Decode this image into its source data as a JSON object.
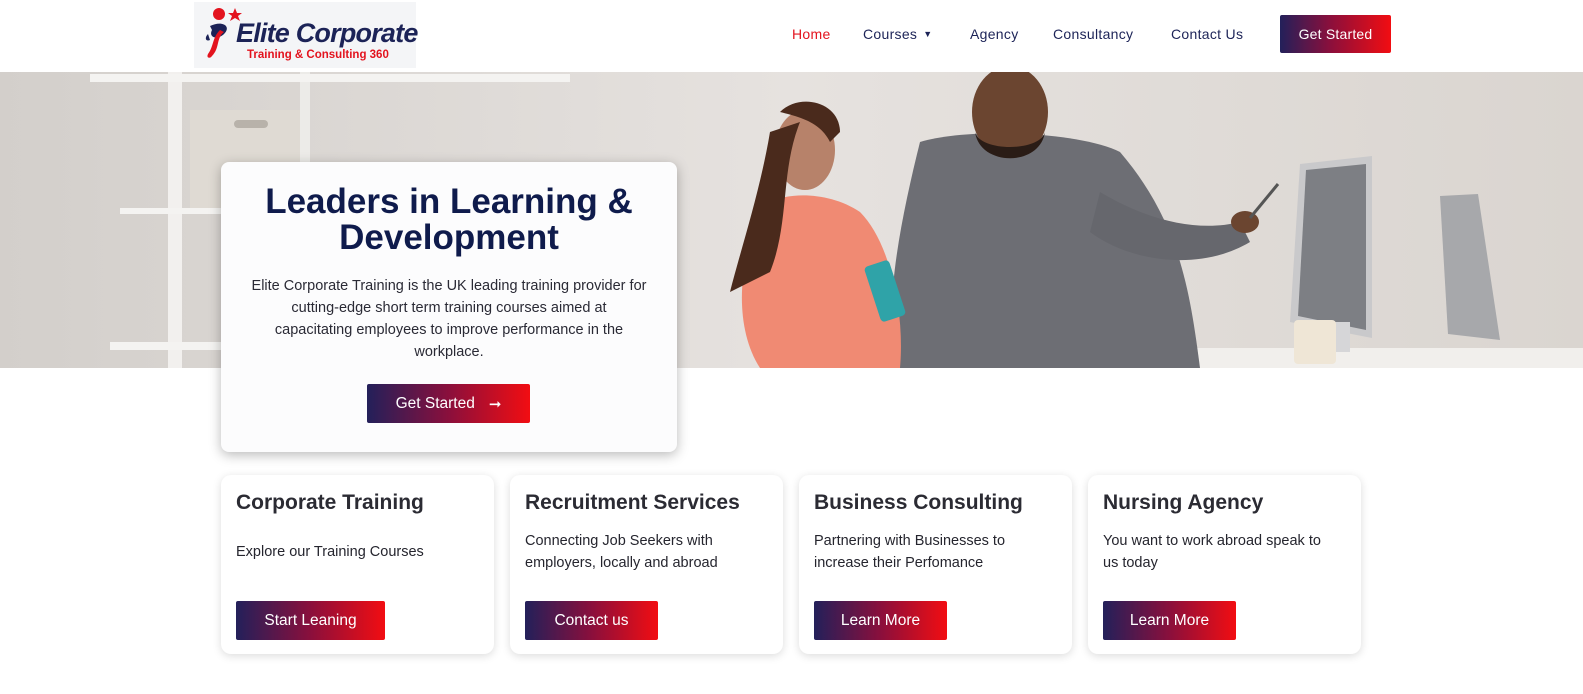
{
  "header": {
    "logo": {
      "title": "Elite Corporate",
      "subtitle": "Training & Consulting 360"
    },
    "nav": [
      {
        "label": "Home",
        "active": true
      },
      {
        "label": "Courses",
        "has_dropdown": true,
        "icon": "chevron-down-icon"
      },
      {
        "label": "Agency"
      },
      {
        "label": "Consultancy"
      },
      {
        "label": "Contact Us"
      }
    ],
    "cta_label": "Get Started"
  },
  "hero": {
    "title": "Leaders in Learning & Development",
    "text": "Elite Corporate Training is the UK leading training provider for cutting-edge short term training courses aimed at capacitating employees to improve performance in the workplace.",
    "button_label": "Get Started",
    "button_icon": "arrow-right-icon"
  },
  "services": [
    {
      "title": "Corporate Training",
      "text": "Explore our Training Courses",
      "button": "Start Leaning"
    },
    {
      "title": "Recruitment Services",
      "text": "Connecting Job Seekers with employers, locally and abroad",
      "button": "Contact us"
    },
    {
      "title": "Business Consulting",
      "text": "Partnering with Businesses to increase their Perfomance",
      "button": "Learn More"
    },
    {
      "title": "Nursing Agency",
      "text": "You want to work abroad speak to us today",
      "button": "Learn More"
    }
  ],
  "colors": {
    "brand_navy": "#1c2357",
    "brand_red": "#e3131e",
    "gradient_start": "#23205a",
    "gradient_end": "#f20d12"
  }
}
